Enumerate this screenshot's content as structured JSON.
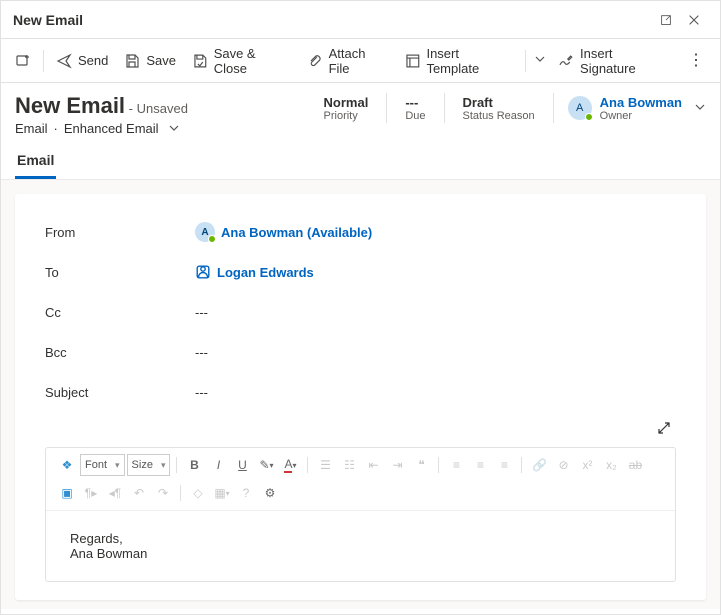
{
  "window": {
    "title": "New Email"
  },
  "commands": {
    "send": "Send",
    "save": "Save",
    "save_close": "Save & Close",
    "attach": "Attach File",
    "insert_template": "Insert Template",
    "insert_signature": "Insert Signature"
  },
  "header": {
    "title": "New Email",
    "status_suffix": "- Unsaved",
    "breadcrumb_entity": "Email",
    "breadcrumb_form": "Enhanced Email",
    "fields": {
      "priority": {
        "value": "Normal",
        "label": "Priority"
      },
      "due": {
        "value": "---",
        "label": "Due"
      },
      "status": {
        "value": "Draft",
        "label": "Status Reason"
      }
    },
    "owner": {
      "initial": "A",
      "name": "Ana Bowman",
      "label": "Owner"
    }
  },
  "tabs": {
    "email": "Email"
  },
  "form": {
    "from_label": "From",
    "to_label": "To",
    "cc_label": "Cc",
    "bcc_label": "Bcc",
    "subject_label": "Subject",
    "from_initial": "A",
    "from_display": "Ana Bowman (Available)",
    "to_display": "Logan Edwards",
    "cc_value": "---",
    "bcc_value": "---",
    "subject_value": "---"
  },
  "rte": {
    "font_label": "Font",
    "size_label": "Size",
    "body": "Regards,\nAna Bowman"
  }
}
